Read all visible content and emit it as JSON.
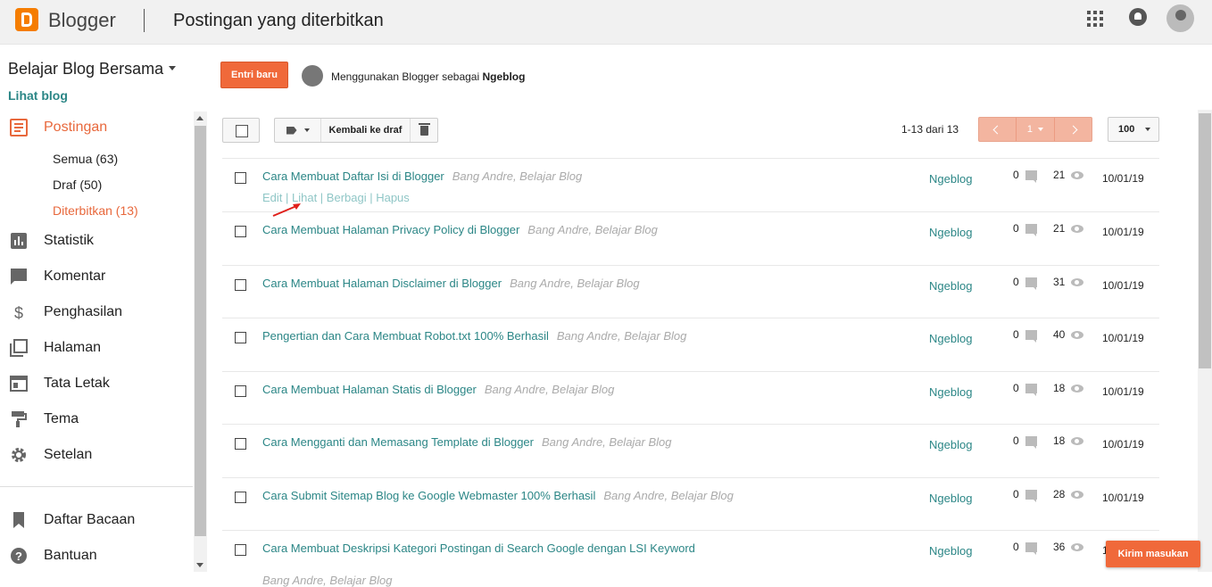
{
  "header": {
    "app_name": "Blogger",
    "page_title": "Postingan yang diterbitkan"
  },
  "sidebar": {
    "blog_name": "Belajar Blog Bersama",
    "view_blog": "Lihat blog",
    "items": [
      {
        "label": "Postingan",
        "icon": "posts-icon"
      },
      {
        "label": "Statistik",
        "icon": "stats-icon"
      },
      {
        "label": "Komentar",
        "icon": "comment-icon"
      },
      {
        "label": "Penghasilan",
        "icon": "dollar-icon"
      },
      {
        "label": "Halaman",
        "icon": "pages-icon"
      },
      {
        "label": "Tata Letak",
        "icon": "layout-icon"
      },
      {
        "label": "Tema",
        "icon": "paint-roller-icon"
      },
      {
        "label": "Setelan",
        "icon": "gear-icon"
      },
      {
        "label": "Daftar Bacaan",
        "icon": "bookmark-icon"
      },
      {
        "label": "Bantuan",
        "icon": "help-icon"
      }
    ],
    "sub_items": [
      "Semua (63)",
      "Draf (50)",
      "Diterbitkan (13)"
    ]
  },
  "main": {
    "new_post_label": "Entri baru",
    "using_prefix": "Menggunakan Blogger sebagai ",
    "using_name": "Ngeblog",
    "revert_label": "Kembali ke draf",
    "count_text": "1-13 dari 13",
    "page_number": "1",
    "per_page": "100",
    "actions": "Edit | Lihat | Berbagi | Hapus",
    "posts": [
      {
        "title": "Cara Membuat Daftar Isi di Blogger",
        "meta": "Bang Andre, Belajar Blog",
        "author": "Ngeblog",
        "comments": "0",
        "views": "21",
        "date": "10/01/19"
      },
      {
        "title": "Cara Membuat Halaman Privacy Policy di Blogger",
        "meta": "Bang Andre, Belajar Blog",
        "author": "Ngeblog",
        "comments": "0",
        "views": "21",
        "date": "10/01/19"
      },
      {
        "title": "Cara Membuat Halaman Disclaimer di Blogger",
        "meta": "Bang Andre, Belajar Blog",
        "author": "Ngeblog",
        "comments": "0",
        "views": "31",
        "date": "10/01/19"
      },
      {
        "title": "Pengertian dan Cara Membuat Robot.txt 100% Berhasil",
        "meta": "Bang Andre, Belajar Blog",
        "author": "Ngeblog",
        "comments": "0",
        "views": "40",
        "date": "10/01/19"
      },
      {
        "title": "Cara Membuat Halaman Statis di Blogger",
        "meta": "Bang Andre, Belajar Blog",
        "author": "Ngeblog",
        "comments": "0",
        "views": "18",
        "date": "10/01/19"
      },
      {
        "title": "Cara Mengganti dan Memasang Template di Blogger",
        "meta": "Bang Andre, Belajar Blog",
        "author": "Ngeblog",
        "comments": "0",
        "views": "18",
        "date": "10/01/19"
      },
      {
        "title": "Cara Submit Sitemap Blog ke Google Webmaster 100% Berhasil",
        "meta": "Bang Andre, Belajar Blog",
        "author": "Ngeblog",
        "comments": "0",
        "views": "28",
        "date": "10/01/19"
      },
      {
        "title": "Cara Membuat Deskripsi Kategori Postingan di Search Google dengan LSI Keyword",
        "meta": "Bang Andre, Belajar Blog",
        "author": "Ngeblog",
        "comments": "0",
        "views": "36",
        "date": "10/01/19"
      }
    ],
    "feedback_label": "Kirim masukan"
  },
  "colors": {
    "accent": "#f0693a",
    "link": "#2b8686",
    "active_nav": "#e8683c"
  }
}
